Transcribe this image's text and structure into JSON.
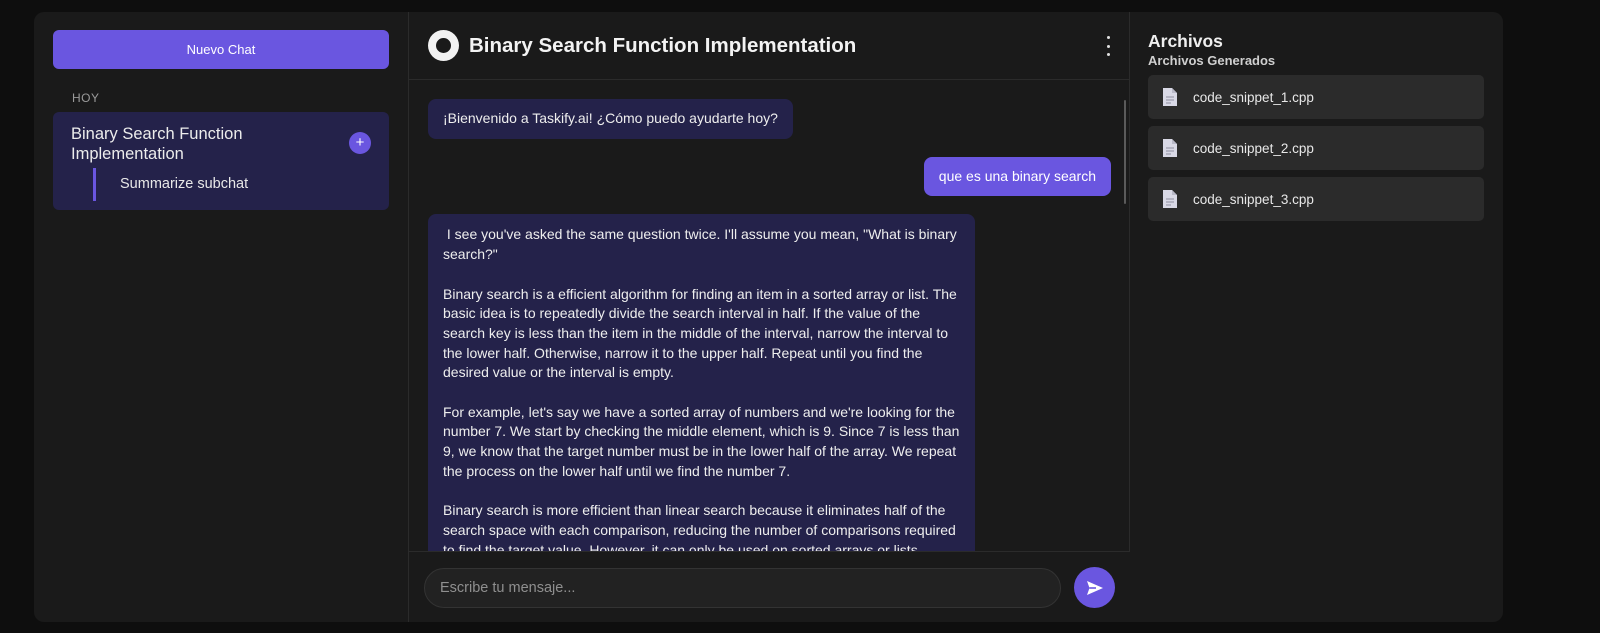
{
  "sidebar": {
    "new_chat_label": "Nuevo Chat",
    "section_label": "HOY",
    "chats": [
      {
        "title": "Binary Search Function Implementation",
        "add_label": "+",
        "subchats": [
          "Summarize subchat"
        ]
      }
    ]
  },
  "header": {
    "title": "Binary Search Function Implementation"
  },
  "messages": [
    {
      "role": "bot",
      "text": "¡Bienvenido a Taskify.ai! ¿Cómo puedo ayudarte hoy?"
    },
    {
      "role": "user",
      "text": "que es una binary search"
    },
    {
      "role": "bot",
      "text": " I see you've asked the same question twice. I'll assume you mean, \"What is binary search?\"\n\nBinary search is a efficient algorithm for finding an item in a sorted array or list. The basic idea is to repeatedly divide the search interval in half. If the value of the search key is less than the item in the middle of the interval, narrow the interval to the lower half. Otherwise, narrow it to the upper half. Repeat until you find the desired value or the interval is empty.\n\nFor example, let's say we have a sorted array of numbers and we're looking for the number 7. We start by checking the middle element, which is 9. Since 7 is less than 9, we know that the target number must be in the lower half of the array. We repeat the process on the lower half until we find the number 7.\n\nBinary search is more efficient than linear search because it eliminates half of the search space with each comparison, reducing the number of comparisons required to find the target value. However, it can only be used on sorted arrays or lists."
    }
  ],
  "composer": {
    "placeholder": "Escribe tu mensaje...",
    "send_icon": "send-icon"
  },
  "files_panel": {
    "title": "Archivos",
    "subtitle": "Archivos Generados",
    "files": [
      "code_snippet_1.cpp",
      "code_snippet_2.cpp",
      "code_snippet_3.cpp"
    ],
    "file_icon": "document-icon"
  },
  "colors": {
    "accent": "#6a56e0",
    "bot_bubble": "#24224a",
    "panel_bg": "#1a1a1a",
    "page_bg": "#0e0e0e"
  }
}
